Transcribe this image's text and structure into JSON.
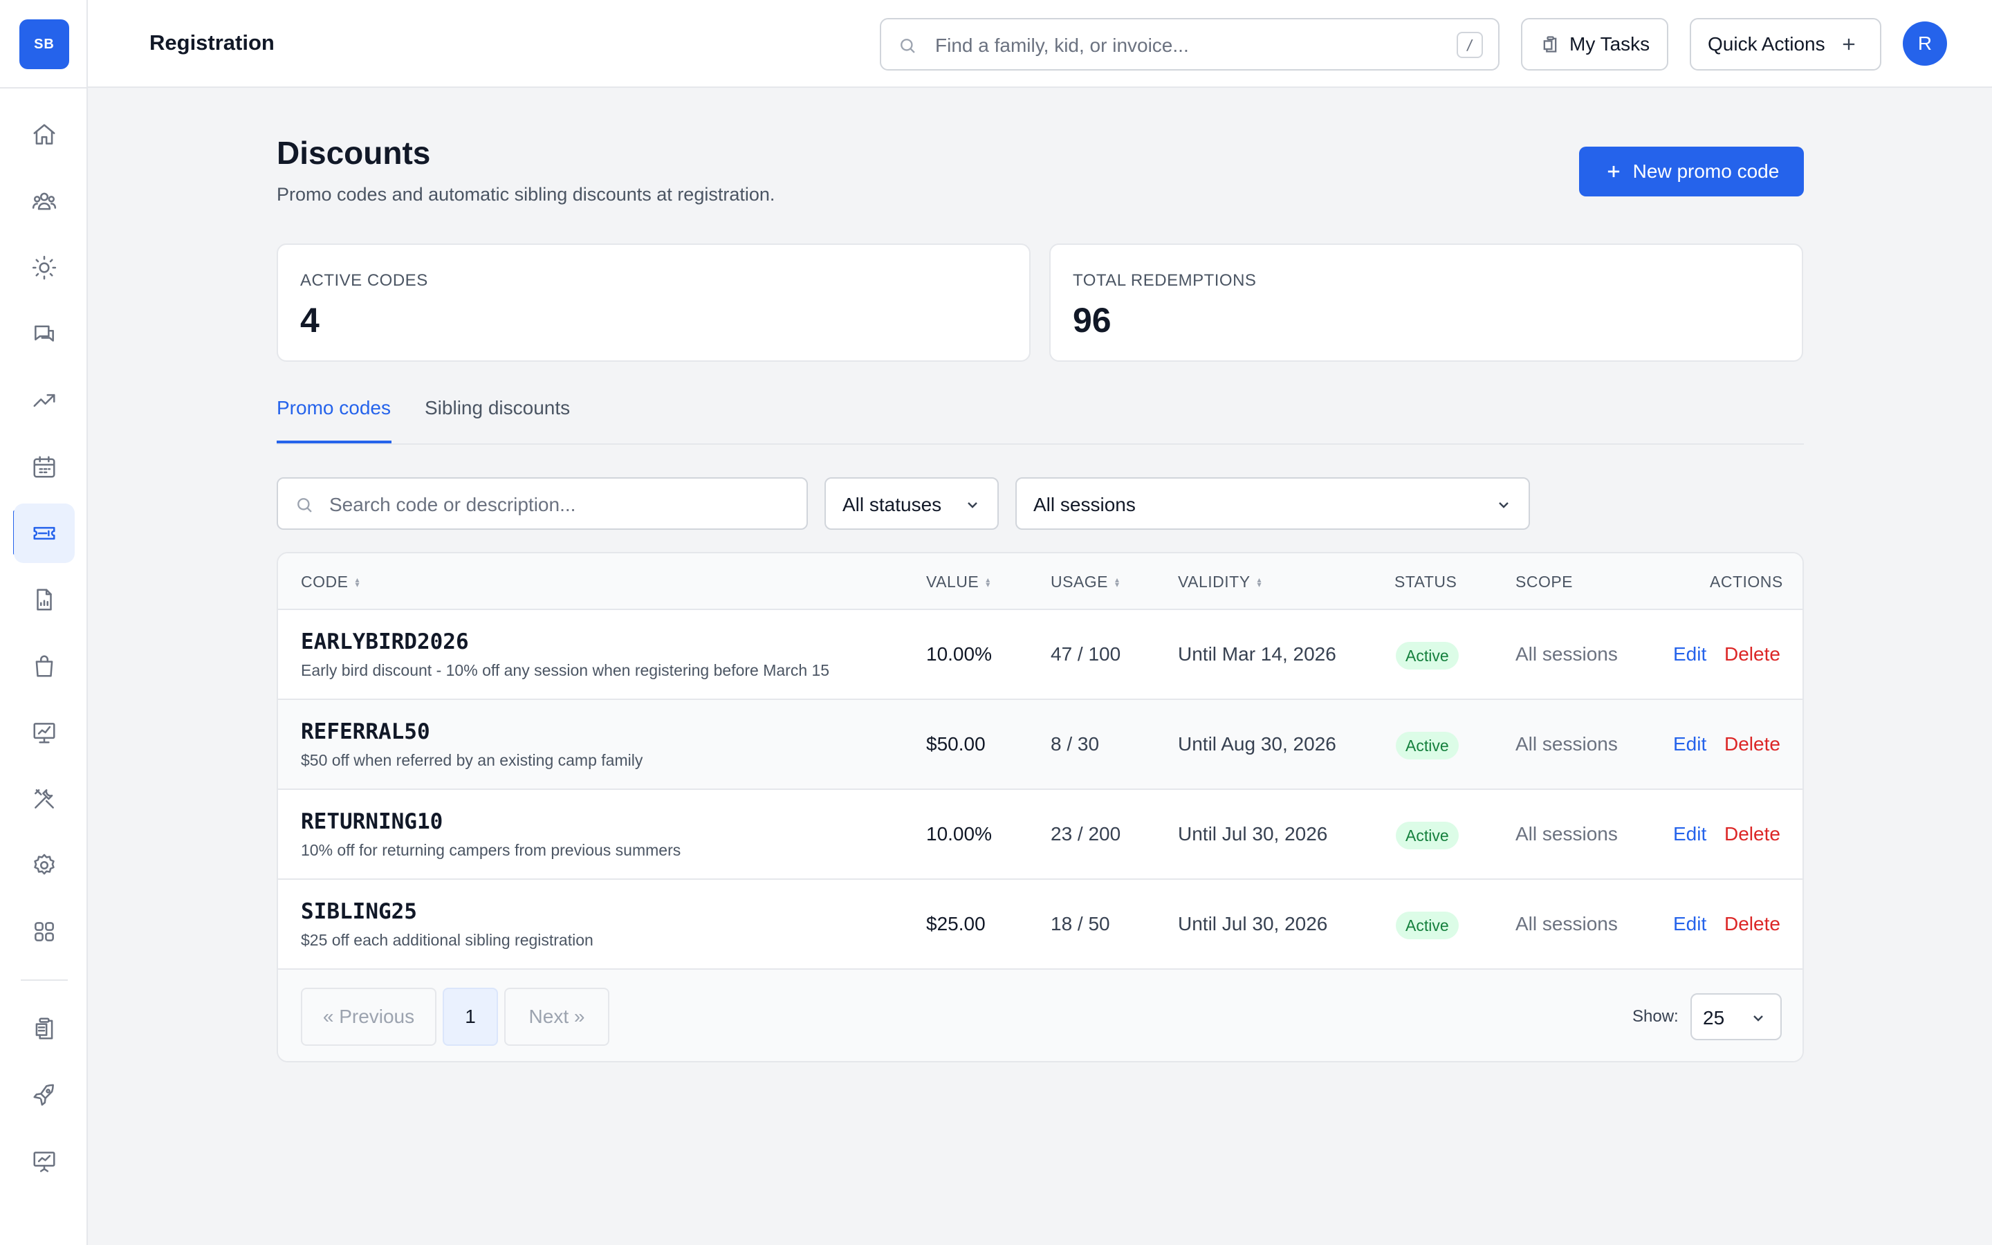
{
  "app": {
    "logo_text": "SB",
    "section_title": "Registration"
  },
  "header": {
    "search_placeholder": "Find a family, kid, or invoice...",
    "search_shortcut": "/",
    "my_tasks_label": "My Tasks",
    "quick_actions_label": "Quick Actions",
    "avatar_initial": "R"
  },
  "sidebar": {
    "active_item": "discounts",
    "items": [
      "home-icon",
      "families-icon",
      "camp-icon",
      "messages-icon",
      "trending-icon",
      "calendar-icon",
      "ticket-icon",
      "report-icon",
      "shop-icon",
      "analytics-icon",
      "tools-icon",
      "settings-icon",
      "apps-icon",
      "clipboard-icon",
      "rocket-icon",
      "presentation-icon"
    ]
  },
  "page": {
    "title": "Discounts",
    "subtitle": "Promo codes and automatic sibling discounts at registration.",
    "new_button_label": "New promo code"
  },
  "stats": {
    "active_codes": {
      "label": "ACTIVE CODES",
      "value": "4"
    },
    "total_redemptions": {
      "label": "TOTAL REDEMPTIONS",
      "value": "96"
    }
  },
  "tabs": [
    {
      "label": "Promo codes",
      "active": true
    },
    {
      "label": "Sibling discounts",
      "active": false
    }
  ],
  "filters": {
    "search_placeholder": "Search code or description...",
    "status_value": "All statuses",
    "session_value": "All sessions"
  },
  "table": {
    "columns": {
      "code": "CODE",
      "value": "VALUE",
      "usage": "USAGE",
      "validity": "VALIDITY",
      "status": "STATUS",
      "scope": "SCOPE",
      "actions": "ACTIONS"
    },
    "edit_label": "Edit",
    "delete_label": "Delete",
    "rows": [
      {
        "code": "EARLYBIRD2026",
        "description": "Early bird discount - 10% off any session when registering before March 15",
        "value": "10.00%",
        "usage": "47 / 100",
        "validity": "Until Mar 14, 2026",
        "status": "Active",
        "scope": "All sessions"
      },
      {
        "code": "REFERRAL50",
        "description": "$50 off when referred by an existing camp family",
        "value": "$50.00",
        "usage": "8 / 30",
        "validity": "Until Aug 30, 2026",
        "status": "Active",
        "scope": "All sessions"
      },
      {
        "code": "RETURNING10",
        "description": "10% off for returning campers from previous summers",
        "value": "10.00%",
        "usage": "23 / 200",
        "validity": "Until Jul 30, 2026",
        "status": "Active",
        "scope": "All sessions"
      },
      {
        "code": "SIBLING25",
        "description": "$25 off each additional sibling registration",
        "value": "$25.00",
        "usage": "18 / 50",
        "validity": "Until Jul 30, 2026",
        "status": "Active",
        "scope": "All sessions"
      }
    ]
  },
  "pagination": {
    "previous_label": "« Previous",
    "current_page": "1",
    "next_label": "Next »",
    "show_label": "Show:",
    "page_size": "25"
  },
  "colors": {
    "accent": "#2563eb",
    "danger": "#dc2626",
    "success_bg": "#dcfce7",
    "success_text": "#15803d"
  }
}
